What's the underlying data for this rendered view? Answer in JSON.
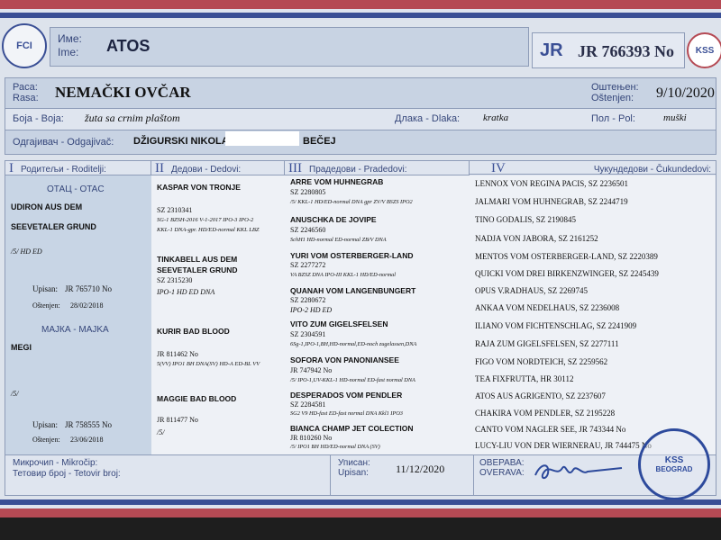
{
  "header": {
    "fci_logo": "FCI",
    "name_label_cyr": "Име:",
    "name_label_lat": "Ime:",
    "dog_name": "ATOS",
    "jr_prefix": "JR",
    "registration": "JR 766393 No",
    "kss_logo": "KSS"
  },
  "details": {
    "breed_label_cyr": "Раса:",
    "breed_label_lat": "Rasa:",
    "breed": "NEMAČKI OVČAR",
    "whelped_label_cyr": "Оштењен:",
    "whelped_label_lat": "Oštenjen:",
    "whelped": "9/10/2020",
    "color_label": "Боја - Boja:",
    "color": "žuta sa crnim plaštom",
    "coat_label": "Длака - Dlaka:",
    "coat": "kratka",
    "sex_label": "Пол - Pol:",
    "sex": "muški",
    "breeder_label": "Одгајивач - Odgajivač:",
    "breeder_name": "DŽIGURSKI NIKOLA,",
    "breeder_city": "BEČEJ"
  },
  "pedigree": {
    "headers": [
      {
        "roman": "I",
        "label": "Родитељи - Roditelji:"
      },
      {
        "roman": "II",
        "label": "Дедови - Dedovi:"
      },
      {
        "roman": "III",
        "label": "Прадедови - Pradedovi:"
      },
      {
        "roman": "IV",
        "label": "Чукундедови - Čukundedovi:"
      }
    ],
    "sire": {
      "title": "ОТАЦ - OTAC",
      "name_1": "UDIRON AUS DEM",
      "name_2": "SEEVETALER GRUND",
      "health": "/5/ HD ED",
      "reg_label": "Upisan:",
      "reg": "JR 765710 No",
      "born_label": "Oštenjen:",
      "born": "28/02/2018"
    },
    "dam": {
      "title": "МАЈКА - MAJKA",
      "name": "MEGI",
      "health": "/5/",
      "reg_label": "Upisan:",
      "reg": "JR 758555 No",
      "born_label": "Oštenjen:",
      "born": "23/06/2018"
    },
    "grandparents": [
      {
        "name_1": "KASPAR VON TRONJE",
        "name_2": "",
        "reg": "SZ 2310341",
        "info_1": "SG-1 BZSH-2016 V-1-2017 IPO-3 IPO-2",
        "info_2": "KKL-1 DNA-gpr. HD/ED-normal KKL LBZ"
      },
      {
        "name_1": "TINKABELL AUS DEM",
        "name_2": "SEEVETALER GRUND",
        "reg": "SZ 2315230",
        "info_1": "IPO-1 HD ED DNA",
        "info_2": ""
      },
      {
        "name_1": "KURIR BAD BLOOD",
        "name_2": "",
        "reg": "JR 811462 No",
        "info_1": "5(VV) IPO1 BH DNA(SV) HD-A ED-BL VV",
        "info_2": ""
      },
      {
        "name_1": "MAGGIE BAD BLOOD",
        "name_2": "",
        "reg": "JR 811477 No",
        "info_1": "/5/",
        "info_2": ""
      }
    ],
    "great_grandparents": [
      {
        "name": "ARRE VOM HUHNEGRAB",
        "reg": "SZ 2280805",
        "info": "/5/ KKL-1 HD/ED-normal DNA gpr ZV/V BSZS IPO2"
      },
      {
        "name": "ANUSCHKA DE JOVIPE",
        "reg": "SZ 2246560",
        "info": "SchH1 HD-normal ED-normal ZB/V DNA"
      },
      {
        "name": "YURI VOM OSTERBERGER-LAND",
        "reg": "SZ 2277272",
        "info": "VA BZSZ DNA IPO-III KKL-1 HD/ED-normal"
      },
      {
        "name": "QUANAH VOM LANGENBUNGERT",
        "reg": "SZ 2280672",
        "info": "IPO-2 HD ED"
      },
      {
        "name": "VITO ZUM GIGELSFELSEN",
        "reg": "SZ 2304591",
        "info": "6Sg-1,IPO-1,BH,HD-normal,ED-noch zugelassen,DNA"
      },
      {
        "name": "SOFORA VON PANONIANSEE",
        "reg": "JR 747942 No",
        "info": "/5/ IPO-1,UV-KKL-1 HD-normal ED-fast normal DNA"
      },
      {
        "name": "DESPERADOS VOM PENDLER",
        "reg": "SZ 2284581",
        "info": "SG2 V9 HD-fast ED-fast normal DNA Kkl1 IPO3"
      },
      {
        "name": "BIANCA CHAMP JET COLECTION",
        "reg": "JR 810260 No",
        "info": "/5/ IPO1 BH HD/ED-normal DNA (SV)"
      }
    ],
    "great_great_grandparents": [
      "LENNOX VON REGINA PACIS, SZ 2236501",
      "JALMARI VOM HUHNEGRAB, SZ 2244719",
      "TINO GODALIS, SZ 2190845",
      "NADJA VON JABORA, SZ 2161252",
      "MENTOS VOM OSTERBERGER-LAND, SZ 2220389",
      "QUICKI VOM DREI BIRKENZWINGER, SZ 2245439",
      "OPUS V.RADHAUS, SZ 2269745",
      "ANKAA VOM NEDELHAUS, SZ 2236008",
      "ILIANO VOM FICHTENSCHLAG, SZ 2241909",
      "RAJA ZUM GIGELSFELSEN, SZ 2277111",
      "FIGO VOM NORDTEICH, SZ 2259562",
      "TEA FIXFRUTTA, HR 30112",
      "ATOS AUS AGRIGENTO, SZ 2237607",
      "CHAKIRA VOM PENDLER, SZ 2195228",
      "CANTO VOM NAGLER SEE, JR 743344 No",
      "LUCY-LIU VON DER WIERNERAU, JR 744475 No"
    ]
  },
  "footer": {
    "microchip_label_cyr": "Микрочип - Mikročip:",
    "tattoo_label": "Тетовир број - Tetovir broj:",
    "registered_label_cyr": "Уписан:",
    "registered_label_lat": "Upisan:",
    "registered_date": "11/12/2020",
    "verified_label_cyr": "ОВЕРАВА:",
    "verified_label_lat": "OVERAVA:",
    "seal_line_1": "KSS",
    "seal_line_2": "BEOGRAD"
  },
  "colors": {
    "accent_blue": "#3a4f95",
    "accent_red": "#b54a54",
    "panel": "#c8d3e3"
  }
}
